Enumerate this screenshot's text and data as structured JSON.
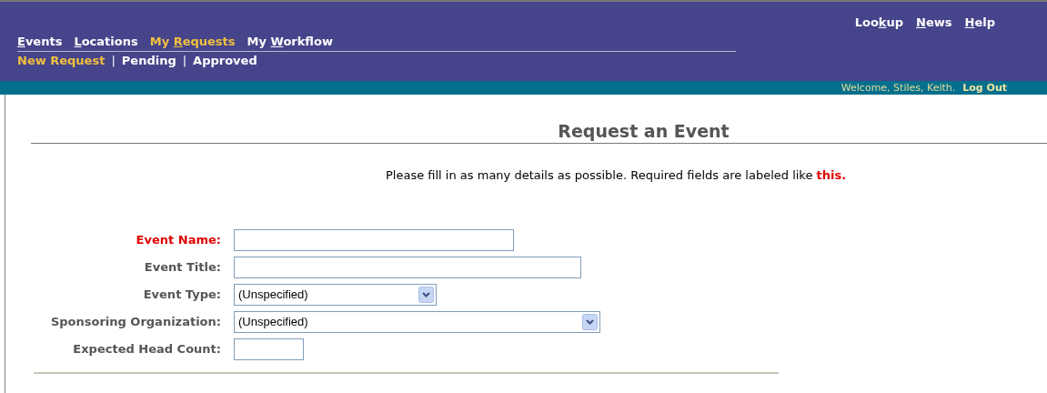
{
  "top_links": [
    {
      "before": "Loo",
      "key": "k",
      "after": "up"
    },
    {
      "key": "N",
      "after": "ews"
    },
    {
      "key": "H",
      "after": "elp"
    }
  ],
  "main_nav": [
    {
      "key": "E",
      "after": "vents",
      "selected": false
    },
    {
      "key": "L",
      "after": "ocations",
      "selected": false
    },
    {
      "before": "My ",
      "key": "R",
      "after": "equests",
      "selected": true
    },
    {
      "before": "My ",
      "key": "W",
      "after": "orkflow",
      "selected": false
    }
  ],
  "sub_nav": [
    {
      "label": "New Request",
      "selected": true
    },
    {
      "label": "Pending",
      "selected": false
    },
    {
      "label": "Approved",
      "selected": false
    }
  ],
  "sub_nav_separator": "|",
  "welcome": "Welcome, Stiles, Keith.",
  "logout": "Log Out",
  "page_title": "Request an Event",
  "instructions": {
    "text": "Please fill in as many details as possible. Required fields are labeled like",
    "example": "this."
  },
  "fields": [
    {
      "label": "Event Name:",
      "kind": "text",
      "required": true
    },
    {
      "label": "Event Title:",
      "kind": "text",
      "required": false
    },
    {
      "label": "Event Type:",
      "kind": "select",
      "required": false,
      "value": "(Unspecified)"
    },
    {
      "label": "Sponsoring Organization:",
      "kind": "select",
      "required": false,
      "value": "(Unspecified)"
    },
    {
      "label": "Expected Head Count:",
      "kind": "text",
      "required": false
    }
  ]
}
